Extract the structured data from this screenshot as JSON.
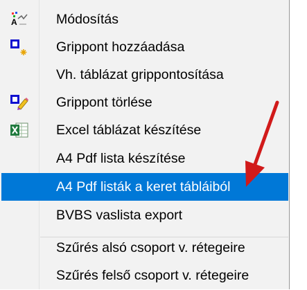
{
  "menu": {
    "items": [
      {
        "label": "Módosítás",
        "icon": "edit-icon"
      },
      {
        "label": "Grippont hozzáadása",
        "icon": "add-point-icon"
      },
      {
        "label": "Vh. táblázat grippontosítása",
        "icon": ""
      },
      {
        "label": "Grippont törlése",
        "icon": "delete-point-icon"
      },
      {
        "label": "Excel táblázat készítése",
        "icon": "excel-icon"
      },
      {
        "label": "A4 Pdf lista készítése",
        "icon": ""
      },
      {
        "label": "A4 Pdf listák a keret tábláiból",
        "icon": "",
        "selected": true
      },
      {
        "label": "BVBS vaslista export",
        "icon": ""
      },
      {
        "label": "Szűrés alsó csoport v. rétegeire",
        "icon": ""
      },
      {
        "label": "Szűrés felső csoport v. rétegeire",
        "icon": ""
      }
    ],
    "selected_color": "#0078d7",
    "background_color": "#f2f2f2"
  },
  "annotation": {
    "arrow_color": "#d11a1a",
    "arrow_icon": "red-arrow-pointer"
  }
}
